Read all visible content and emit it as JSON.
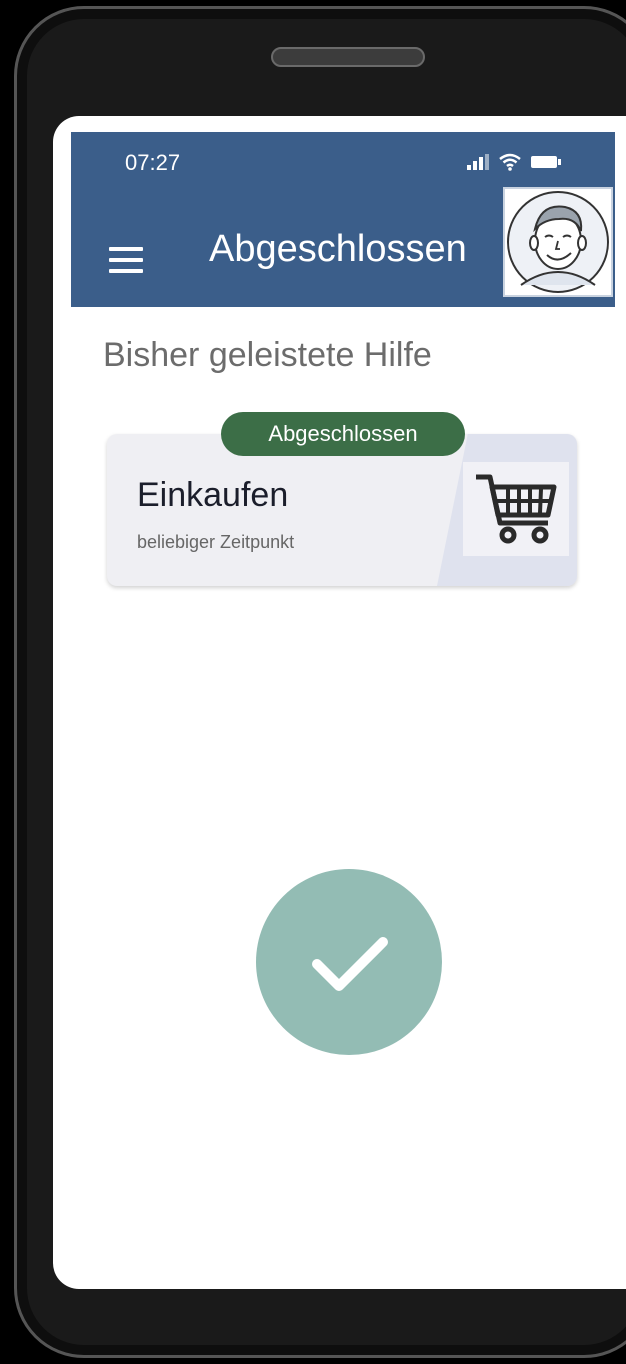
{
  "status": {
    "time": "07:27"
  },
  "appbar": {
    "title": "Abgeschlossen",
    "menu_icon": "menu-icon",
    "avatar_icon": "user-avatar"
  },
  "section": {
    "title": "Bisher geleistete Hilfe"
  },
  "card": {
    "badge": "Abgeschlossen",
    "title": "Einkaufen",
    "subtitle": "beliebiger Zeitpunkt",
    "icon": "shopping-cart-icon"
  },
  "confirm": {
    "icon": "checkmark-icon"
  },
  "colors": {
    "appbar": "#3b5e8a",
    "badge": "#3c6e47",
    "check_circle": "#93bcb4",
    "card_bg": "#efeff3"
  }
}
